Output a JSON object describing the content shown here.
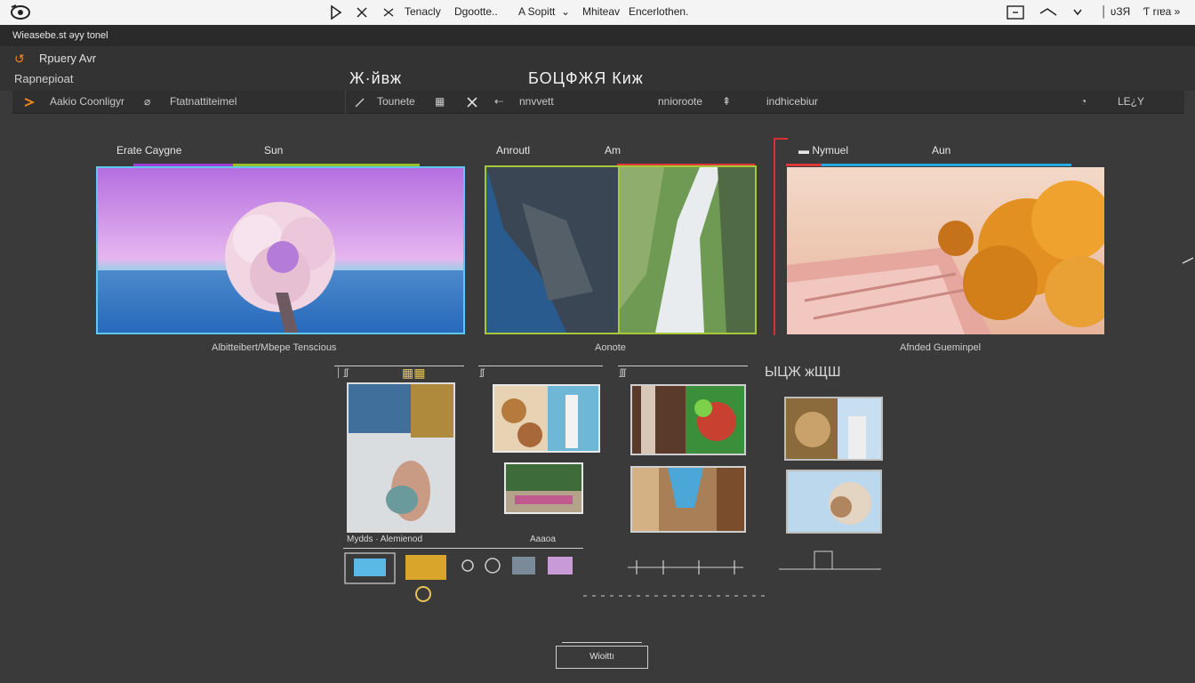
{
  "menubar": {
    "items": [
      "Tenacly",
      "Dgootte..",
      "A Sopitt",
      "Mhiteav",
      "Encerlothen."
    ],
    "right_items": [
      "│ ʋЗЯ",
      "Ƭ rıɐa »"
    ]
  },
  "titlestrip": {
    "text": "Wieasebe.st əyy tonel"
  },
  "panelhead": {
    "row1": "Rpuery Avr",
    "row2": "Rapnepioat",
    "big_left": "Ж·йвж",
    "big_right": "БОЦФЖЯ Киж"
  },
  "toolbar": {
    "items": [
      "Aakio Coonligyr",
      "Ftatnattiteimel",
      "Tounete",
      "nnvvett",
      "nnioroote",
      "indhicebiur",
      "LE¿Y"
    ]
  },
  "cards": [
    {
      "tab_left": "Erate Caygne",
      "tab_right": "Sun",
      "caption": "Albitteibert/Mbepe Tenscious"
    },
    {
      "tab_left": "Anroutl",
      "tab_right": "Am",
      "caption": "Aonote"
    },
    {
      "tab_left": "Nymuel",
      "tab_right": "Aun",
      "caption": "Afnded Gueminpel"
    }
  ],
  "grid": {
    "group_labels": [
      "│ ʃʃ",
      "ʃʃ",
      "ʃʃʃ",
      "ЫЦЖ жЩШ"
    ],
    "captions": [
      "Mydds · Alemienod",
      "Aaaoa"
    ]
  },
  "footer": {
    "button": "Wioittı"
  },
  "colors": {
    "accent_orange": "#f08a1c",
    "card1_border": "#5fc6ee",
    "card2_border": "#a8c83a",
    "card3_border": "#d63030",
    "tab_purple": "#9b3fd6",
    "tab_green": "#9bbf2a",
    "tab_cyan": "#27a8e0",
    "tab_red": "#e03838"
  }
}
